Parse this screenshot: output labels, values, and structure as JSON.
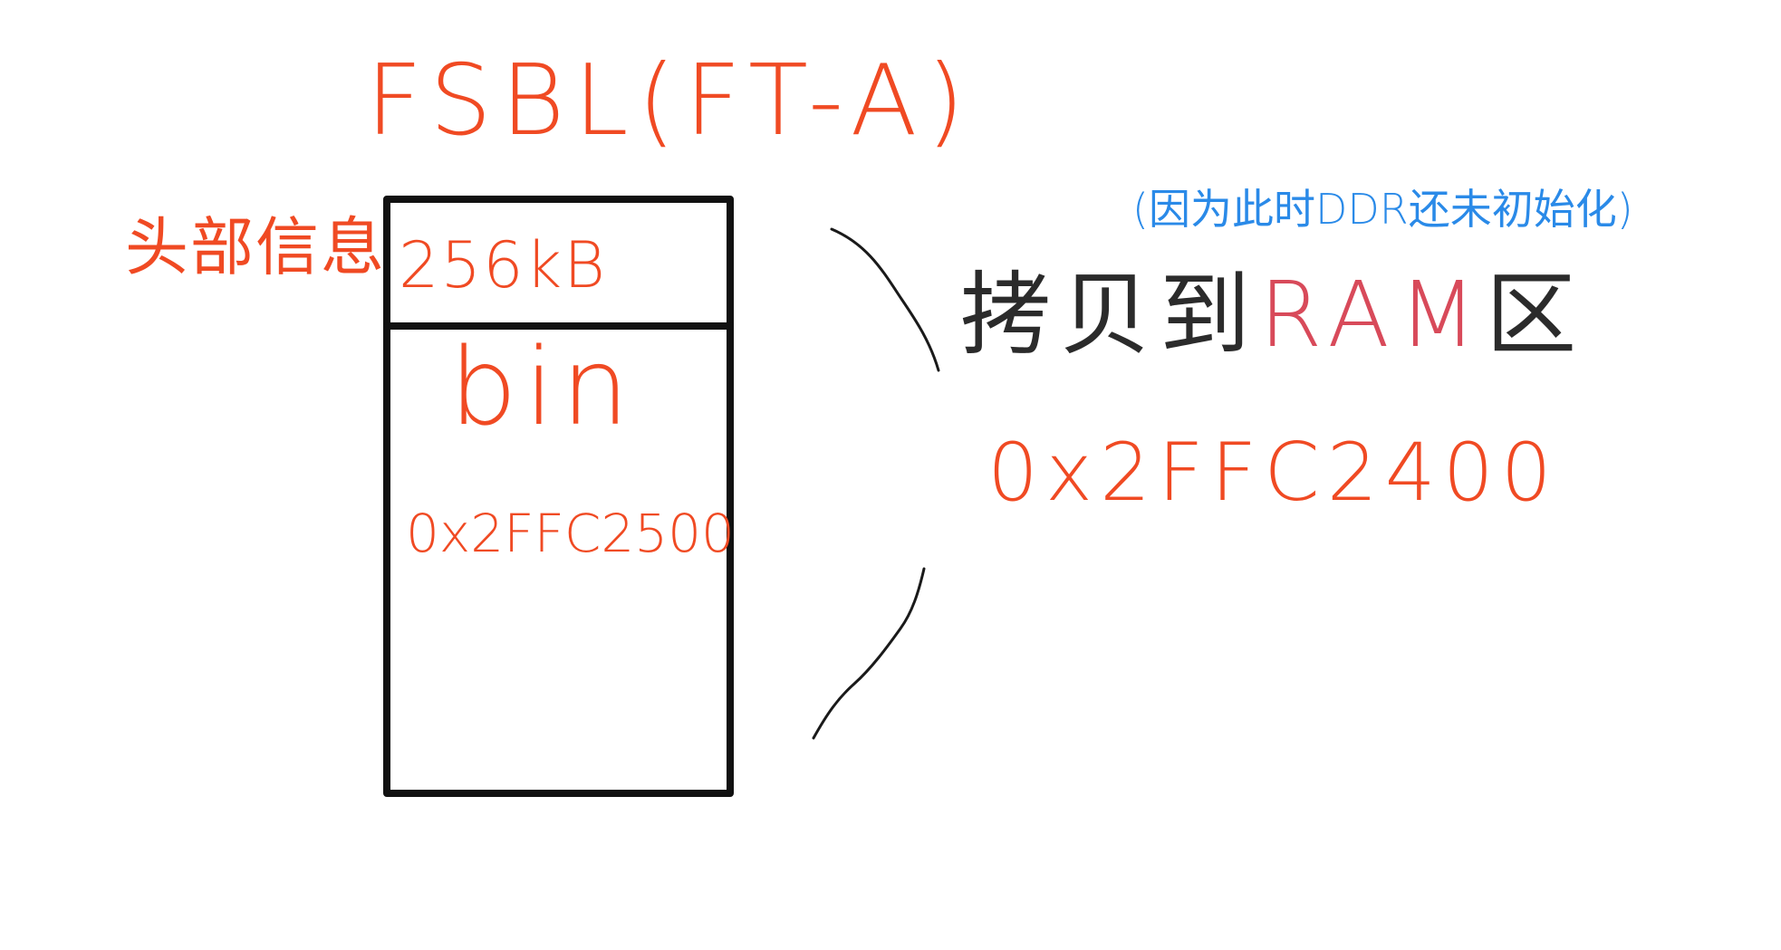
{
  "diagram": {
    "title": "FSBL(FT-A)",
    "header": {
      "label": "头部信息",
      "size": "256kB"
    },
    "bin": {
      "label": "bin",
      "address": "0x2FFC2500"
    },
    "note": "(因为此时DDR还未初始化)",
    "copy": {
      "prefix": "拷贝到",
      "ram": "RAM",
      "suffix": "区",
      "address": "0x2FFC2400"
    },
    "colors": {
      "red": "#f04a23",
      "blue": "#2a8ae8",
      "black": "#111111",
      "dark_text": "#2b2b2b",
      "ram_red": "#d84a5a"
    }
  }
}
